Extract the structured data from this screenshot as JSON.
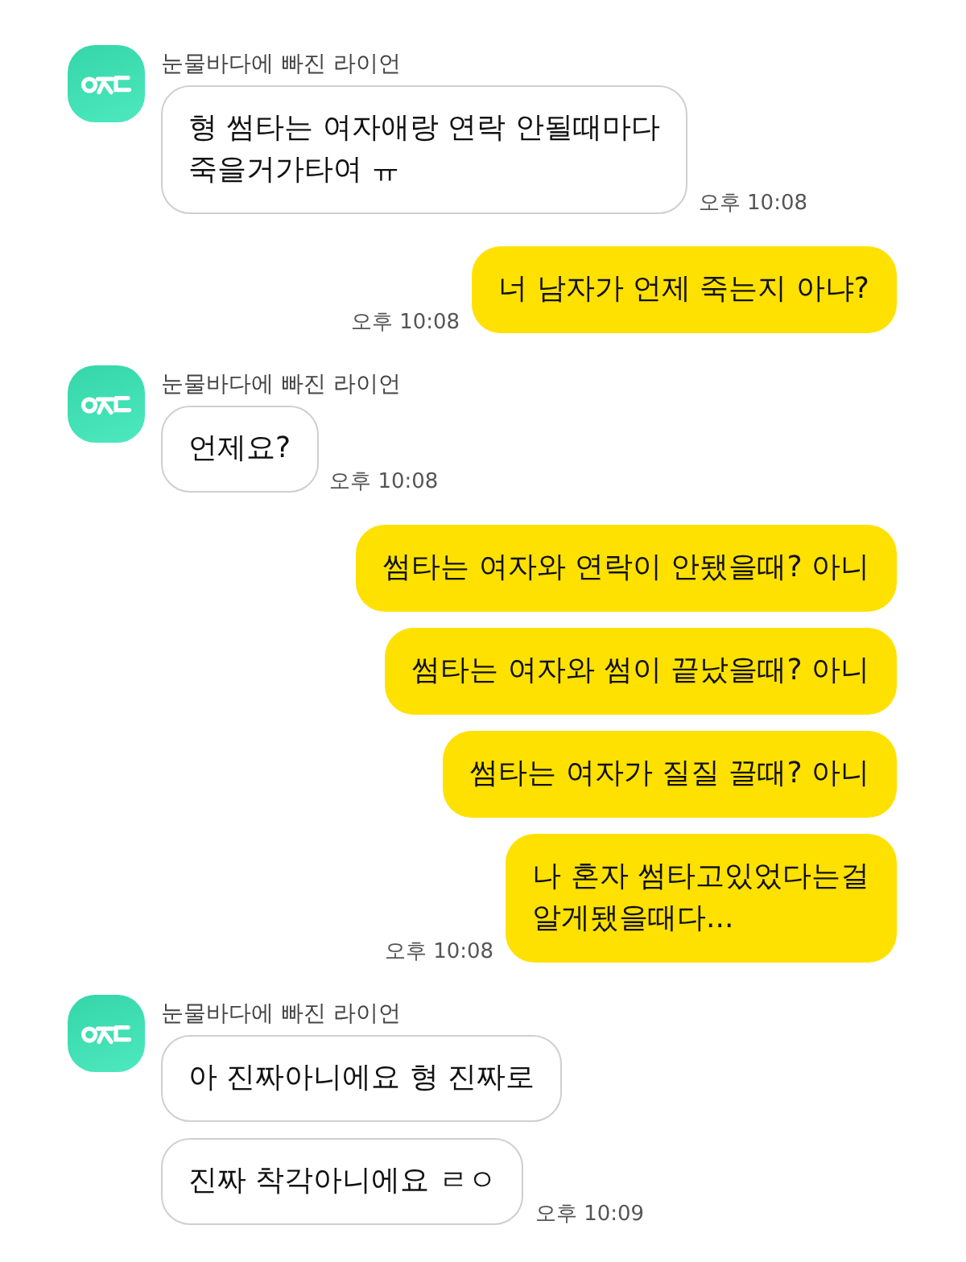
{
  "messages": [
    {
      "kind": "incoming",
      "sender": "눈물바다에 빠진 라이언",
      "bubbles": [
        "형 썸타는 여자애랑 연락 안될때마다\n죽을거가타여 ㅠ"
      ],
      "time": "오후 10:08"
    },
    {
      "kind": "outgoing",
      "bubbles": [
        "너 남자가 언제 죽는지 아냐?"
      ],
      "time": "오후 10:08"
    },
    {
      "kind": "incoming",
      "sender": "눈물바다에 빠진 라이언",
      "bubbles": [
        "언제요?"
      ],
      "time": "오후 10:08"
    },
    {
      "kind": "outgoing",
      "bubbles": [
        "썸타는 여자와 연락이 안됐을때? 아니",
        "썸타는 여자와 썸이 끝났을때? 아니",
        "썸타는 여자가 질질 끌때? 아니",
        "나 혼자 썸타고있었다는걸\n알게됐을때다..."
      ],
      "time": "오후 10:08"
    },
    {
      "kind": "incoming",
      "sender": "눈물바다에 빠진 라이언",
      "bubbles": [
        "아 진짜아니에요 형 진짜로",
        "진짜 착각아니에요 ㄹㅇ"
      ],
      "time": "오후 10:09"
    }
  ]
}
